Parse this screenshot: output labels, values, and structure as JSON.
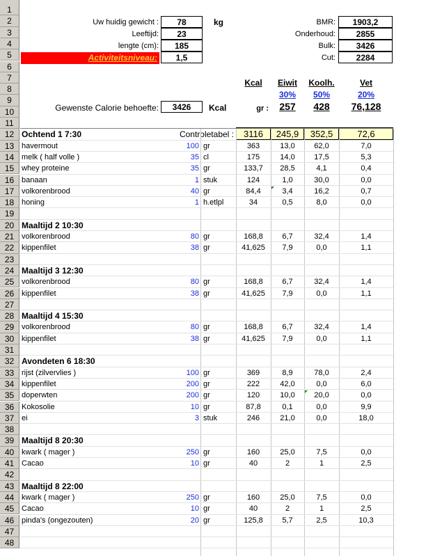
{
  "profile": {
    "weight_label": "Uw huidig gewicht :",
    "weight_value": "78",
    "weight_unit": "kg",
    "age_label": "Leeftijd:",
    "age_value": "23",
    "height_label": "lengte (cm):",
    "height_value": "185",
    "activity_label": "Activiteitsniveau:",
    "activity_value": "1,5"
  },
  "targets": {
    "bmr_label": "BMR:",
    "bmr_value": "1903,2",
    "maintenance_label": "Onderhoud:",
    "maintenance_value": "2855",
    "bulk_label": "Bulk:",
    "bulk_value": "3426",
    "cut_label": "Cut:",
    "cut_value": "2284"
  },
  "macro_header": {
    "kcal": "Kcal",
    "protein": "Eiwit",
    "carbs": "Koolh.",
    "fat": "Vet",
    "protein_pct": "30%",
    "carbs_pct": "50%",
    "fat_pct": "20%",
    "desired_label": "Gewenste Calorie behoefte:",
    "desired_value": "3426",
    "desired_unit": "Kcal",
    "gr_label": "gr :",
    "protein_gr": "257",
    "carbs_gr": "428",
    "fat_gr": "76,128"
  },
  "control": {
    "label": "Controletabel :",
    "kcal": "3116",
    "protein": "245,9",
    "carbs": "352,5",
    "fat": "72,6"
  },
  "row_numbers": [
    "1",
    "2",
    "3",
    "4",
    "5",
    "6",
    "7",
    "8",
    "9",
    "10",
    "11",
    "12",
    "13",
    "14",
    "15",
    "16",
    "17",
    "18",
    "19",
    "20",
    "21",
    "22",
    "23",
    "24",
    "25",
    "26",
    "27",
    "28",
    "29",
    "30",
    "31",
    "32",
    "33",
    "34",
    "35",
    "36",
    "37",
    "38",
    "39",
    "40",
    "41",
    "42",
    "43",
    "44",
    "45",
    "46",
    "47",
    "48"
  ],
  "meals": [
    {
      "title": "Ochtend 1 7:30",
      "row": 12,
      "items": [
        {
          "name": "havermout",
          "qty": "100",
          "unit": "gr",
          "kcal": "363",
          "protein": "13,0",
          "carbs": "62,0",
          "fat": "7,0"
        },
        {
          "name": "melk ( half volle )",
          "qty": "35",
          "unit": "cl",
          "kcal": "175",
          "protein": "14,0",
          "carbs": "17,5",
          "fat": "5,3"
        },
        {
          "name": "whey proteine",
          "qty": "35",
          "unit": "gr",
          "kcal": "133,7",
          "protein": "28,5",
          "carbs": "4,1",
          "fat": "0,4"
        },
        {
          "name": "banaan",
          "qty": "1",
          "unit": "stuk",
          "kcal": "124",
          "protein": "1,0",
          "carbs": "30,0",
          "fat": "0,0"
        },
        {
          "name": "volkorenbrood",
          "qty": "40",
          "unit": "gr",
          "kcal": "84,4",
          "protein": "3,4",
          "carbs": "16,2",
          "fat": "0,7"
        },
        {
          "name": "honing",
          "qty": "1",
          "unit": "h.etlpl",
          "kcal": "34",
          "protein": "0,5",
          "carbs": "8,0",
          "fat": "0,0"
        }
      ]
    },
    {
      "title": "Maaltijd 2 10:30",
      "row": 20,
      "items": [
        {
          "name": "volkorenbrood",
          "qty": "80",
          "unit": "gr",
          "kcal": "168,8",
          "protein": "6,7",
          "carbs": "32,4",
          "fat": "1,4"
        },
        {
          "name": "kippenfilet",
          "qty": "38",
          "unit": "gr",
          "kcal": "41,625",
          "protein": "7,9",
          "carbs": "0,0",
          "fat": "1,1"
        }
      ]
    },
    {
      "title": "Maaltijd 3 12:30",
      "row": 24,
      "items": [
        {
          "name": "volkorenbrood",
          "qty": "80",
          "unit": "gr",
          "kcal": "168,8",
          "protein": "6,7",
          "carbs": "32,4",
          "fat": "1,4"
        },
        {
          "name": "kippenfilet",
          "qty": "38",
          "unit": "gr",
          "kcal": "41,625",
          "protein": "7,9",
          "carbs": "0,0",
          "fat": "1,1"
        }
      ]
    },
    {
      "title": "Maaltijd 4 15:30",
      "row": 28,
      "items": [
        {
          "name": "volkorenbrood",
          "qty": "80",
          "unit": "gr",
          "kcal": "168,8",
          "protein": "6,7",
          "carbs": "32,4",
          "fat": "1,4"
        },
        {
          "name": "kippenfilet",
          "qty": "38",
          "unit": "gr",
          "kcal": "41,625",
          "protein": "7,9",
          "carbs": "0,0",
          "fat": "1,1"
        }
      ]
    },
    {
      "title": "Avondeten 6 18:30",
      "row": 32,
      "items": [
        {
          "name": "rijst (zilvervlies )",
          "qty": "100",
          "unit": "gr",
          "kcal": "369",
          "protein": "8,9",
          "carbs": "78,0",
          "fat": "2,4"
        },
        {
          "name": "kippenfilet",
          "qty": "200",
          "unit": "gr",
          "kcal": "222",
          "protein": "42,0",
          "carbs": "0,0",
          "fat": "6,0"
        },
        {
          "name": "doperwten",
          "qty": "200",
          "unit": "gr",
          "kcal": "120",
          "protein": "10,0",
          "carbs": "20,0",
          "fat": "0,0"
        },
        {
          "name": "Kokosolie",
          "qty": "10",
          "unit": "gr",
          "kcal": "87,8",
          "protein": "0,1",
          "carbs": "0,0",
          "fat": "9,9"
        },
        {
          "name": "ei",
          "qty": "3",
          "unit": "stuk",
          "kcal": "246",
          "protein": "21,0",
          "carbs": "0,0",
          "fat": "18,0"
        }
      ]
    },
    {
      "title": "Maaltijd 8 20:30",
      "row": 39,
      "items": [
        {
          "name": "kwark ( mager )",
          "qty": "250",
          "unit": "gr",
          "kcal": "160",
          "protein": "25,0",
          "carbs": "7,5",
          "fat": "0,0"
        },
        {
          "name": "Cacao",
          "qty": "10",
          "unit": "gr",
          "kcal": "40",
          "protein": "2",
          "carbs": "1",
          "fat": "2,5"
        }
      ]
    },
    {
      "title": "Maaltijd 8 22:00",
      "row": 43,
      "items": [
        {
          "name": "kwark ( mager )",
          "qty": "250",
          "unit": "gr",
          "kcal": "160",
          "protein": "25,0",
          "carbs": "7,5",
          "fat": "0,0"
        },
        {
          "name": "Cacao",
          "qty": "10",
          "unit": "gr",
          "kcal": "40",
          "protein": "2",
          "carbs": "1",
          "fat": "2,5"
        },
        {
          "name": "pinda's (ongezouten)",
          "qty": "20",
          "unit": "gr",
          "kcal": "125,8",
          "protein": "5,7",
          "carbs": "2,5",
          "fat": "10,3"
        }
      ]
    }
  ]
}
